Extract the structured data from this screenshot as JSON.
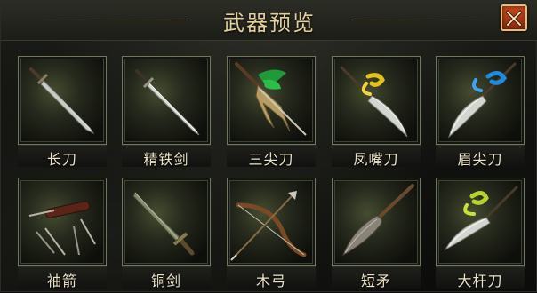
{
  "title": "武器预览",
  "close_button": {
    "icon": "close-x-icon",
    "label": "X"
  },
  "colors": {
    "title_gold": "#e2cf9c",
    "slot_border_green": "#6c7a5a",
    "close_red": "#c74a1e",
    "label_text": "#ece3c8"
  },
  "weapons": [
    {
      "name": "长刀",
      "icon": "long-blade-icon"
    },
    {
      "name": "精铁剑",
      "icon": "iron-sword-icon"
    },
    {
      "name": "三尖刀",
      "icon": "three-point-blade-icon"
    },
    {
      "name": "凤嘴刀",
      "icon": "phoenix-beak-blade-icon"
    },
    {
      "name": "眉尖刀",
      "icon": "brow-point-blade-icon"
    },
    {
      "name": "袖箭",
      "icon": "sleeve-arrow-icon"
    },
    {
      "name": "铜剑",
      "icon": "bronze-sword-icon"
    },
    {
      "name": "木弓",
      "icon": "wooden-bow-icon"
    },
    {
      "name": "短矛",
      "icon": "short-spear-icon"
    },
    {
      "name": "大杆刀",
      "icon": "long-pole-blade-icon"
    }
  ]
}
